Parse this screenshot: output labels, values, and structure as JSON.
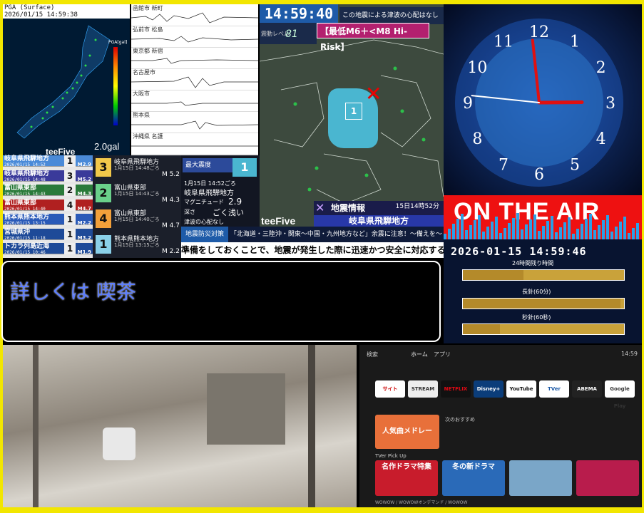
{
  "map_panel": {
    "stamp": "PGA (Surface)\n2026/01/15 14:59:38",
    "gal": "2.0gal",
    "brand": "teeFive",
    "pga_label": "PGA[gal]"
  },
  "wave_panel": {
    "rows": [
      "函館市 新町",
      "弘前市 松島",
      "東京都 新宿",
      "名古屋市",
      "大阪市",
      "熊本県",
      "沖縄県 名護"
    ]
  },
  "center": {
    "time": "14:59:40",
    "no_tsunami": "この地震による津波の心配はなし",
    "level_label": "震動レベル",
    "level_value": "81",
    "risk": "【最低M6＋<M8 Hi-Risk】",
    "region_intensity": "1",
    "quake_info": "地震情報",
    "quake_time": "15日14時52分",
    "quake_region": "岐阜県飛騨地方",
    "brand": "teeFive"
  },
  "quake_list": [
    {
      "name": "岐阜県飛騨地方",
      "date": "2026/01/15 14:52",
      "mag": "M2.9",
      "int": "1",
      "color": "#4a8ad8"
    },
    {
      "name": "岐阜県飛騨地方",
      "date": "2026/01/15 14:48",
      "mag": "M5.2",
      "int": "3",
      "color": "#3a3a9a"
    },
    {
      "name": "富山県東部",
      "date": "2026/01/15 14:43",
      "mag": "M4.3",
      "int": "2",
      "color": "#2a7a3a"
    },
    {
      "name": "富山県東部",
      "date": "2026/01/15 14:40",
      "mag": "M4.7",
      "int": "4",
      "color": "#b02020"
    },
    {
      "name": "熊本県熊本地方",
      "date": "2026/01/15 13:15",
      "mag": "M2.2",
      "int": "1",
      "color": "#2a5ab8"
    },
    {
      "name": "宮城県沖",
      "date": "2026/01/15 11:18",
      "mag": "M3.2",
      "int": "1",
      "color": "#1e4a98"
    },
    {
      "name": "トカラ列島近海",
      "date": "2026/01/15 10:46",
      "mag": "M1.9",
      "int": "1",
      "color": "#1e4a98"
    }
  ],
  "detail": [
    {
      "int": "3",
      "place": "岐阜県飛騨地方",
      "time": "1月15日 14:48ごろ",
      "mag": "M 5.2",
      "color": "#f2c84a"
    },
    {
      "int": "2",
      "place": "富山県東部",
      "time": "1月15日 14:43ごろ",
      "mag": "M 4.3",
      "color": "#6ad08a"
    },
    {
      "int": "4",
      "place": "富山県東部",
      "time": "1月15日 14:40ごろ",
      "mag": "M 4.7",
      "color": "#f2a03a"
    },
    {
      "int": "1",
      "place": "熊本県熊本地方",
      "time": "1月15日 13:15ごろ",
      "mag": "M 2.2",
      "color": "#8ad0e8"
    }
  ],
  "summary": {
    "max_label": "最大震度",
    "max_value": "1",
    "time": "1月15日 14:52ごろ",
    "place": "岐阜県飛騨地方",
    "mag_label": "マグニチュード",
    "mag": "2.9",
    "depth_label": "深さ",
    "depth": "ごく浅い",
    "tsunami": "津波の心配なし"
  },
  "bousai": {
    "tag": "地震防災対策",
    "text": "「北海道・三陸沖・関東～中国・九州地方など」余震に注意！～備えを～"
  },
  "ticker": "準備をしておくことで、地震が発生した際に迅速かつ安全に対応するこ",
  "chat": {
    "message": "詳しくは 喫茶"
  },
  "clock": {
    "numerals": [
      "12",
      "1",
      "2",
      "3",
      "4",
      "5",
      "6",
      "7",
      "8",
      "9",
      "10",
      "11"
    ],
    "onair": "ON THE AIR",
    "datetime": "2026-01-15 14:59:46",
    "remain_label": "24時間残り時間",
    "long_label": "長針(60分)",
    "second_label": "秒針(60秒)",
    "remain_fraction": 0.375,
    "long_fraction": 0.98,
    "second_fraction": 0.23
  },
  "tv": {
    "nav": [
      "検索",
      "ホーム",
      "アプリ"
    ],
    "clock": "14:59",
    "apps": [
      {
        "label": "サイト",
        "bg": "#fff",
        "fg": "#c00"
      },
      {
        "label": "STREAM",
        "bg": "#eee",
        "fg": "#333"
      },
      {
        "label": "NETFLIX",
        "bg": "#111",
        "fg": "#e50914"
      },
      {
        "label": "Disney+",
        "bg": "#0b3d7a",
        "fg": "#fff"
      },
      {
        "label": "YouTube",
        "bg": "#fff",
        "fg": "#111"
      },
      {
        "label": "TVer",
        "bg": "#fff",
        "fg": "#1e5ba8"
      },
      {
        "label": "ABEMA",
        "bg": "#222",
        "fg": "#fff"
      },
      {
        "label": "Google Play",
        "bg": "#fff",
        "fg": "#333"
      }
    ],
    "section1": "次のおすすめ",
    "promo": "人気曲メドレー",
    "section2": "TVer Pick Up",
    "tiles": [
      "名作ドラマ特集",
      "冬の新ドラマ",
      "",
      ""
    ],
    "footer": "WOWOW / WOWOWオンデマンド / WOWOW"
  }
}
